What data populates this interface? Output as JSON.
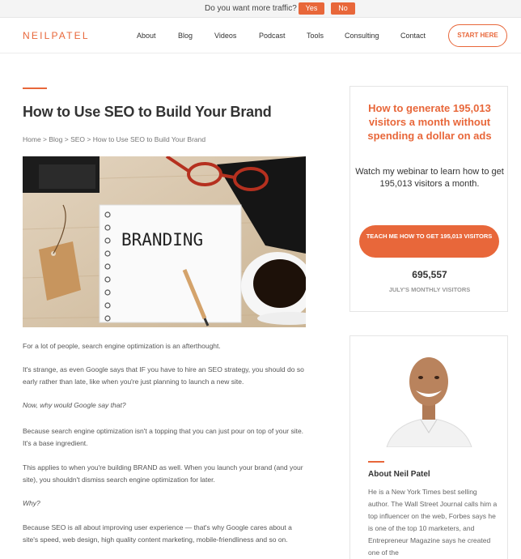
{
  "topbar": {
    "question": "Do you want more traffic?",
    "yes": "Yes",
    "no": "No"
  },
  "header": {
    "logo": "NEILPATEL",
    "nav": [
      "About",
      "Blog",
      "Videos",
      "Podcast",
      "Tools",
      "Consulting",
      "Contact"
    ],
    "cta": "START HERE"
  },
  "article": {
    "title": "How to Use SEO to Build Your Brand",
    "breadcrumb": [
      "Home",
      "Blog",
      "SEO",
      "How to Use SEO to Build Your Brand"
    ],
    "breadcrumb_sep": " > ",
    "hero_word": "BRANDING",
    "paragraphs": [
      "For a lot of people, search engine optimization is an afterthought.",
      "It's strange, as even Google says that IF you have to hire an SEO strategy, you should do so early rather than late, like when you're just planning to launch a new site.",
      "Now, why would Google say that?",
      "Because search engine optimization isn't a topping that you can just pour on top of your site. It's a base ingredient.",
      "This applies to when you're building BRAND as well. When you launch your brand (and your site), you shouldn't dismiss search engine optimization for later.",
      "Why?",
      "Because SEO is all about improving user experience — that's why Google cares about a site's speed, web design, high quality content marketing, mobile-friendliness and so on."
    ]
  },
  "sidebar": {
    "webinar": {
      "headline": "How to generate 195,013 visitors a month without spending a dollar on ads",
      "sub": "Watch my webinar to learn how to get 195,013 visitors a month.",
      "button": "TEACH ME HOW TO GET 195,013 VISITORS",
      "count": "695,557",
      "count_label": "JULY'S MONTHLY VISITORS"
    },
    "about": {
      "title": "About Neil Patel",
      "bio": "He is a New York Times best selling author. The Wall Street Journal calls him a top influencer on the web, Forbes says he is one of the top 10 marketers, and Entrepreneur Magazine says he created one of the"
    }
  },
  "colors": {
    "accent": "#e8673a",
    "text": "#333333"
  }
}
